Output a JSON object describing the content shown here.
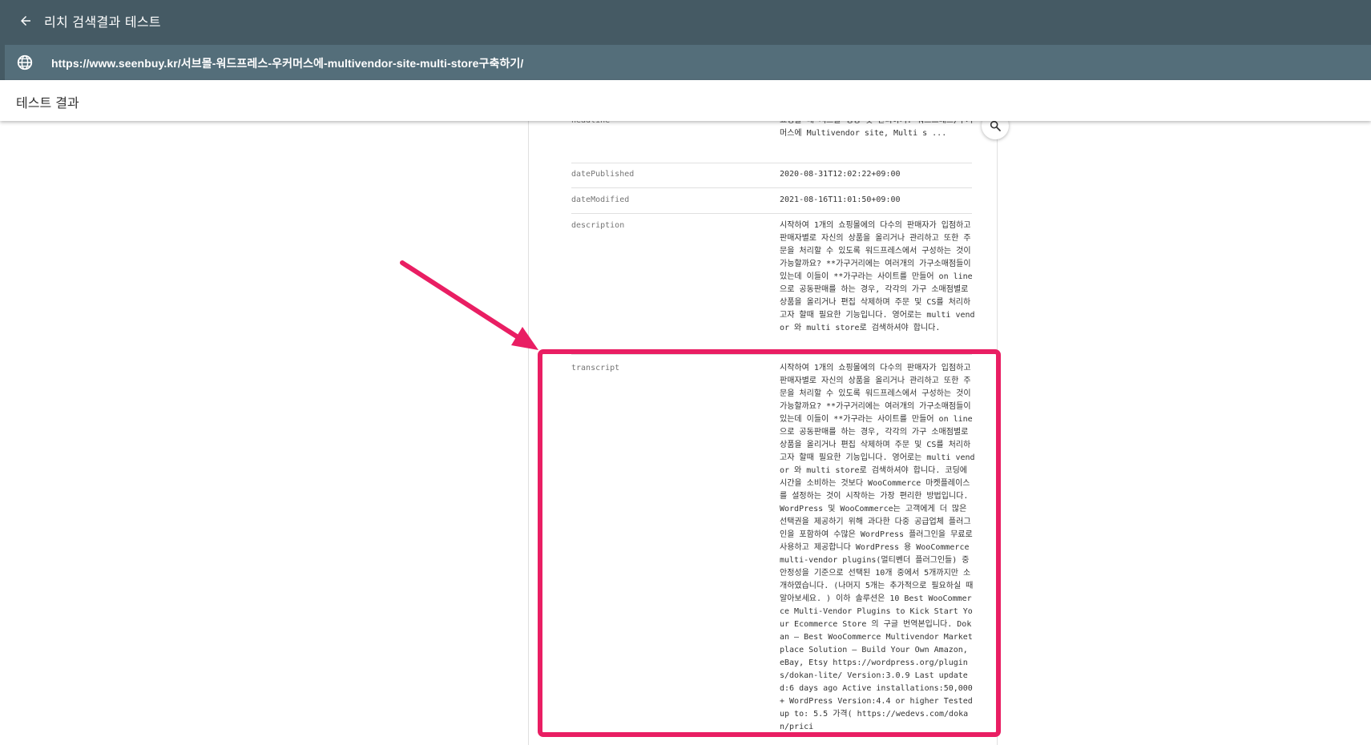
{
  "header": {
    "title": "리치 검색결과 테스트"
  },
  "url_bar": {
    "url": "https://www.seenbuy.kr/서브몰-워드프레스-우커머스에-multivendor-site-multi-store구축하기/"
  },
  "result_header": {
    "title": "테스트 결과"
  },
  "rows": [
    {
      "key": "headline",
      "value": "쇼핑몰 내 서브몰 생성 및 관리하기: 워드프레스/우커머스에 Multivendor site, Multi s ..."
    },
    {
      "key": "datePublished",
      "value": "2020-08-31T12:02:22+09:00"
    },
    {
      "key": "dateModified",
      "value": "2021-08-16T11:01:50+09:00"
    },
    {
      "key": "description",
      "value": "시작하여 1개의 쇼핑몰에의 다수의 판매자가 입점하고 판매자별로 자신의 상품을 올리거나 관리하고 또한 주문을 처리할 수 있도록 워드프레스에서 구성하는 것이 가능할까요? **가구거리에는 여러개의 가구소매점들이 있는데 이들이 **가구라는 사이트를 만들어 on line으로 공동판매를 하는 경우, 각각의 가구 소매점별로 상품을 올리거나 편집 삭제하며 주문 및 CS를 처리하고자 할때 필요한 기능입니다. 영어로는 multi vendor 와 multi store로 검색하셔야 합니다."
    },
    {
      "key": "transcript",
      "value": "시작하여 1개의 쇼핑몰에의 다수의 판매자가 입점하고 판매자별로 자신의 상품을 올리거나 관리하고 또한 주문을 처리할 수 있도록 워드프레스에서 구성하는 것이 가능할까요? **가구거리에는 여러개의 가구소매점들이 있는데 이들이 **가구라는 사이트를 만들어 on line으로 공동판매를 하는 경우, 각각의 가구 소매점별로 상품을 올리거나 편집 삭제하며 주문 및 CS를 처리하고자 할때 필요한 기능입니다. 영어로는 multi vendor 와 multi store로 검색하셔야 합니다. 코딩에 시간을 소비하는 것보다 WooCommerce 마켓플레이스를 설정하는 것이 시작하는 가장 편리한 방법입니다. WordPress 및 WooCommerce는 고객에게 더 많은 선택권을 제공하기 위해 과다한 다중 공급업체 플러그인을 포함하여 수많은 WordPress 플러그인을 무료로 사용하고 제공합니다 WordPress 용 WooCommerce multi-vendor plugins(멀티벤더 플러그인들) 중 안정성을 기준으로 선택된 10개 중에서 5개까지만 소개하였습니다. (나머지 5개는 추가적으로 필요하실 때 알아보세요. ) 이하 솔루션은 10 Best WooCommerce Multi-Vendor Plugins to Kick Start Your Ecommerce Store 의 구글 번역본입니다. Dokan – Best WooCommerce Multivendor Marketplace Solution – Build Your Own Amazon, eBay, Etsy https://wordpress.org/plugins/dokan-lite/ Version:3.0.9 Last updated:6 days ago Active installations:50,000+ WordPress Version:4.4 or higher Tested up to: 5.5 가격( https://wedevs.com/dokan/prici"
    }
  ],
  "colors": {
    "header_bg": "#455a64",
    "url_bar_bg": "#546e7a",
    "highlight": "#e91e63"
  },
  "icons": {
    "back": "arrow-left-icon",
    "globe": "globe-icon",
    "search": "search-icon"
  }
}
